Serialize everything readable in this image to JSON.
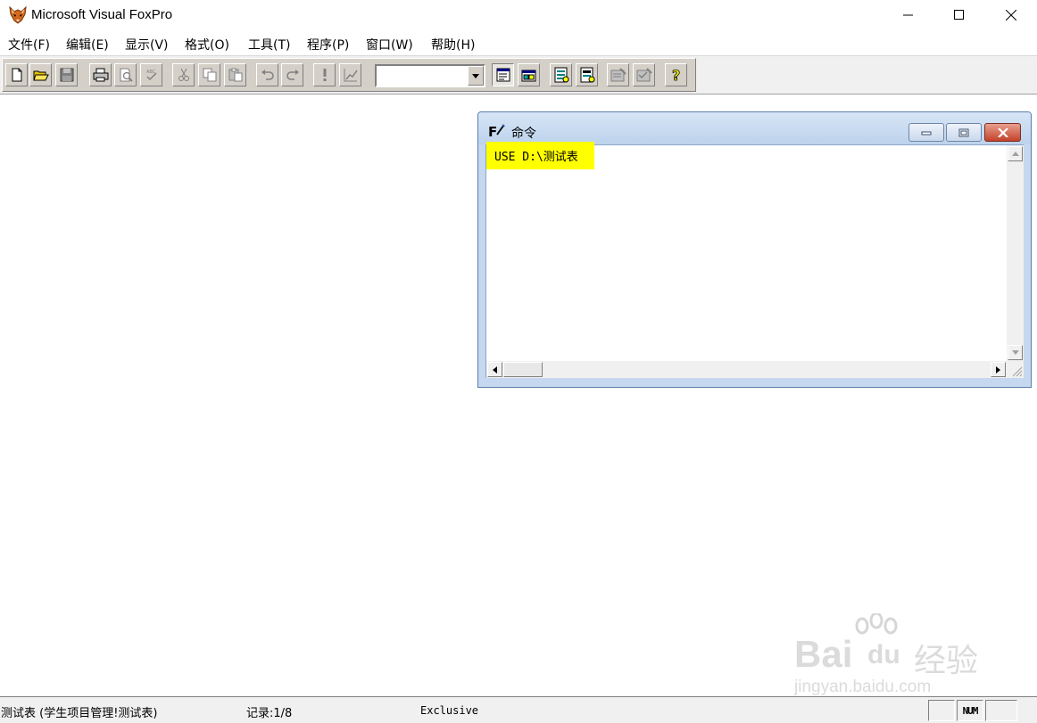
{
  "app": {
    "title": "Microsoft Visual FoxPro",
    "icon": "foxpro-fox-icon"
  },
  "window_controls": [
    "minimize-icon",
    "maximize-icon",
    "close-icon"
  ],
  "menu": [
    {
      "label": "文件(F)"
    },
    {
      "label": "编辑(E)"
    },
    {
      "label": "显示(V)"
    },
    {
      "label": "格式(O)"
    },
    {
      "label": "工具(T)"
    },
    {
      "label": "程序(P)"
    },
    {
      "label": "窗口(W)"
    },
    {
      "label": "帮助(H)"
    }
  ],
  "toolbar": {
    "buttons": [
      "new-icon",
      "open-icon",
      "save-icon",
      "print-icon",
      "print-preview-icon",
      "spelling-icon",
      "cut-icon",
      "copy-icon",
      "paste-icon",
      "undo-icon",
      "redo-icon",
      "run-icon",
      "modify-form-icon",
      "command-window-icon",
      "view-window-icon",
      "form-designer-icon",
      "report-designer-icon",
      "form-wizard-icon",
      "autoform-icon",
      "help-icon"
    ],
    "combo_value": ""
  },
  "command_window": {
    "title": "命令",
    "icon": "command-window-icon",
    "lines": [
      "USE D:\\测试表"
    ],
    "highlight_color": "#ffff00"
  },
  "watermark": {
    "brand_latin": "Bai",
    "brand_du": "du",
    "brand_cn": "经验",
    "url": "jingyan.baidu.com"
  },
  "statusbar": {
    "table": "测试表 (学生项目管理!测试表)",
    "record": "记录:1/8",
    "mode": "Exclusive",
    "num_indicator": "NUM"
  },
  "colors": {
    "toolbar_bg": "#d4d0c8",
    "cmd_frame": "#c5d8ef",
    "close_btn": "#c4422b"
  }
}
